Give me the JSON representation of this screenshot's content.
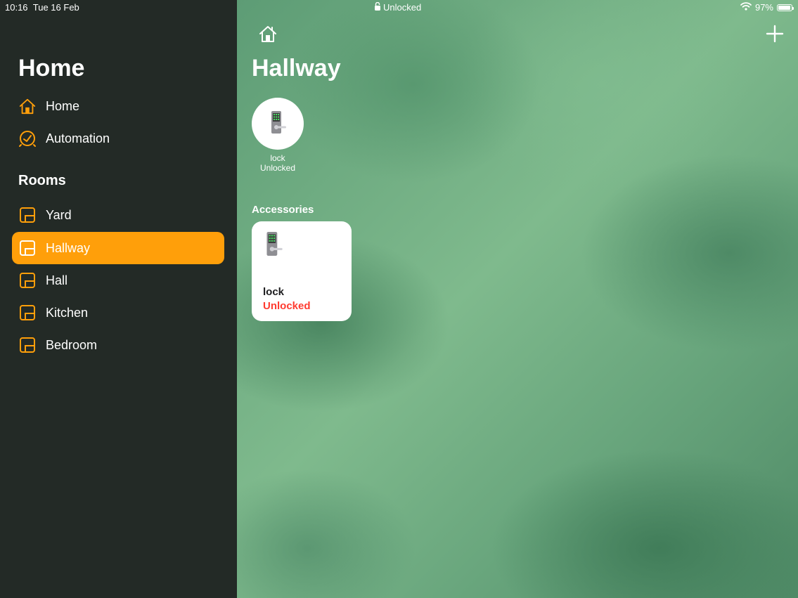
{
  "status_bar": {
    "time": "10:16",
    "date": "Tue 16 Feb",
    "center_text": "Unlocked",
    "battery": "97%",
    "battery_level": 0.97
  },
  "sidebar": {
    "title": "Home",
    "nav": [
      {
        "label": "Home",
        "icon": "house-icon"
      },
      {
        "label": "Automation",
        "icon": "clock-icon"
      }
    ],
    "rooms_title": "Rooms",
    "rooms": [
      {
        "label": "Yard",
        "active": false
      },
      {
        "label": "Hallway",
        "active": true
      },
      {
        "label": "Hall",
        "active": false
      },
      {
        "label": "Kitchen",
        "active": false
      },
      {
        "label": "Bedroom",
        "active": false
      }
    ]
  },
  "main": {
    "title": "Hallway",
    "quick_tile": {
      "name": "lock",
      "state": "Unlocked"
    },
    "accessories_label": "Accessories",
    "accessory": {
      "name": "lock",
      "state": "Unlocked"
    }
  },
  "colors": {
    "accent": "#ff9f0a",
    "sidebar_bg": "#232a26",
    "unlocked_red": "#ff3b30"
  }
}
